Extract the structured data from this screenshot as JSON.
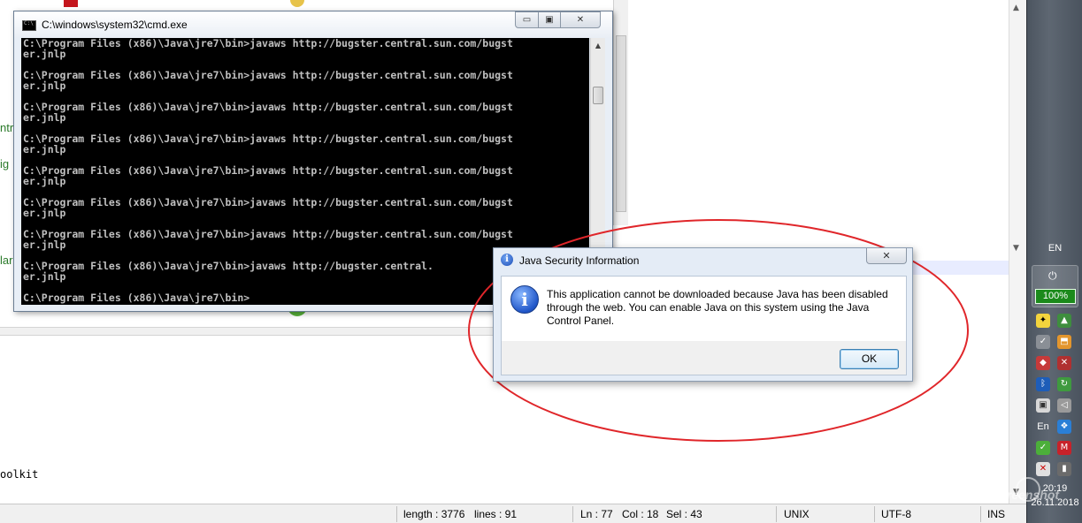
{
  "cmd_window": {
    "title": "C:\\windows\\system32\\cmd.exe",
    "buttons": {
      "minimize": "▭",
      "maximize": "▣",
      "close": "✕"
    },
    "lines": [
      "C:\\Program Files (x86)\\Java\\jre7\\bin>javaws http://bugster.central.sun.com/bugst",
      "er.jnlp",
      "",
      "C:\\Program Files (x86)\\Java\\jre7\\bin>javaws http://bugster.central.sun.com/bugst",
      "er.jnlp",
      "",
      "C:\\Program Files (x86)\\Java\\jre7\\bin>javaws http://bugster.central.sun.com/bugst",
      "er.jnlp",
      "",
      "C:\\Program Files (x86)\\Java\\jre7\\bin>javaws http://bugster.central.sun.com/bugst",
      "er.jnlp",
      "",
      "C:\\Program Files (x86)\\Java\\jre7\\bin>javaws http://bugster.central.sun.com/bugst",
      "er.jnlp",
      "",
      "C:\\Program Files (x86)\\Java\\jre7\\bin>javaws http://bugster.central.sun.com/bugst",
      "er.jnlp",
      "",
      "C:\\Program Files (x86)\\Java\\jre7\\bin>javaws http://bugster.central.sun.com/bugst",
      "er.jnlp",
      "",
      "C:\\Program Files (x86)\\Java\\jre7\\bin>javaws http://bugster.central.",
      "er.jnlp",
      "",
      "C:\\Program Files (x86)\\Java\\jre7\\bin>"
    ]
  },
  "dialog": {
    "title": "Java Security Information",
    "close_label": "✕",
    "message": "This application cannot be downloaded because Java has been disabled through the web. You can enable Java on this system using the Java Control Panel.",
    "ok_label": "OK",
    "icon": "info-icon"
  },
  "background": {
    "left_fragments": [
      "ntr",
      "ig",
      "lar"
    ],
    "toolkit_text": "oolkit"
  },
  "status_bar": {
    "length": "length : 3776",
    "lines": "lines : 91",
    "ln": "Ln : 77",
    "col": "Col : 18",
    "sel": "Sel : 43",
    "eol": "UNIX",
    "encoding": "UTF-8",
    "mode": "INS"
  },
  "taskbar": {
    "language": "EN",
    "battery": "100%",
    "tray_lang": "En",
    "time": "20:19",
    "date": "26.11.2018",
    "watermark": "ijScreenshot"
  },
  "colors": {
    "annotation": "#e0262a",
    "console_bg": "#000000",
    "console_fg": "#c0c0c0",
    "battery": "#1b8a1b"
  }
}
